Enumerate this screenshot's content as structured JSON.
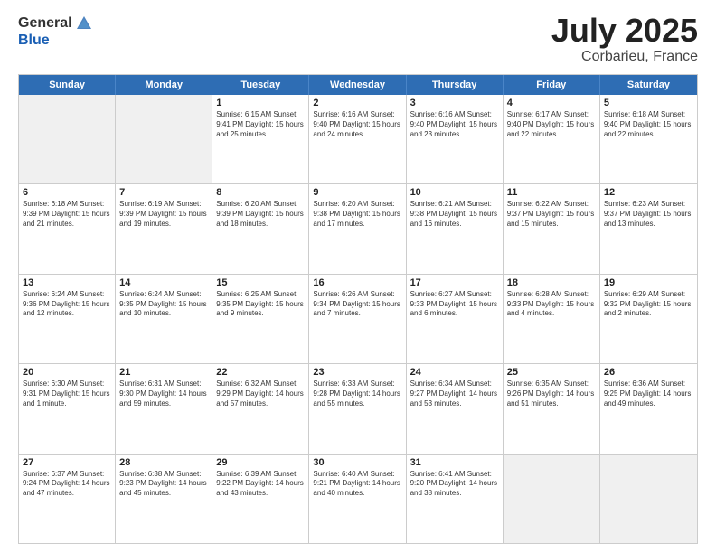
{
  "header": {
    "logo_general": "General",
    "logo_blue": "Blue",
    "title": "July 2025",
    "subtitle": "Corbarieu, France"
  },
  "weekdays": [
    "Sunday",
    "Monday",
    "Tuesday",
    "Wednesday",
    "Thursday",
    "Friday",
    "Saturday"
  ],
  "weeks": [
    [
      {
        "day": "",
        "text": "",
        "shaded": true
      },
      {
        "day": "",
        "text": "",
        "shaded": true
      },
      {
        "day": "1",
        "text": "Sunrise: 6:15 AM\nSunset: 9:41 PM\nDaylight: 15 hours\nand 25 minutes."
      },
      {
        "day": "2",
        "text": "Sunrise: 6:16 AM\nSunset: 9:40 PM\nDaylight: 15 hours\nand 24 minutes."
      },
      {
        "day": "3",
        "text": "Sunrise: 6:16 AM\nSunset: 9:40 PM\nDaylight: 15 hours\nand 23 minutes."
      },
      {
        "day": "4",
        "text": "Sunrise: 6:17 AM\nSunset: 9:40 PM\nDaylight: 15 hours\nand 22 minutes."
      },
      {
        "day": "5",
        "text": "Sunrise: 6:18 AM\nSunset: 9:40 PM\nDaylight: 15 hours\nand 22 minutes."
      }
    ],
    [
      {
        "day": "6",
        "text": "Sunrise: 6:18 AM\nSunset: 9:39 PM\nDaylight: 15 hours\nand 21 minutes."
      },
      {
        "day": "7",
        "text": "Sunrise: 6:19 AM\nSunset: 9:39 PM\nDaylight: 15 hours\nand 19 minutes."
      },
      {
        "day": "8",
        "text": "Sunrise: 6:20 AM\nSunset: 9:39 PM\nDaylight: 15 hours\nand 18 minutes."
      },
      {
        "day": "9",
        "text": "Sunrise: 6:20 AM\nSunset: 9:38 PM\nDaylight: 15 hours\nand 17 minutes."
      },
      {
        "day": "10",
        "text": "Sunrise: 6:21 AM\nSunset: 9:38 PM\nDaylight: 15 hours\nand 16 minutes."
      },
      {
        "day": "11",
        "text": "Sunrise: 6:22 AM\nSunset: 9:37 PM\nDaylight: 15 hours\nand 15 minutes."
      },
      {
        "day": "12",
        "text": "Sunrise: 6:23 AM\nSunset: 9:37 PM\nDaylight: 15 hours\nand 13 minutes."
      }
    ],
    [
      {
        "day": "13",
        "text": "Sunrise: 6:24 AM\nSunset: 9:36 PM\nDaylight: 15 hours\nand 12 minutes."
      },
      {
        "day": "14",
        "text": "Sunrise: 6:24 AM\nSunset: 9:35 PM\nDaylight: 15 hours\nand 10 minutes."
      },
      {
        "day": "15",
        "text": "Sunrise: 6:25 AM\nSunset: 9:35 PM\nDaylight: 15 hours\nand 9 minutes."
      },
      {
        "day": "16",
        "text": "Sunrise: 6:26 AM\nSunset: 9:34 PM\nDaylight: 15 hours\nand 7 minutes."
      },
      {
        "day": "17",
        "text": "Sunrise: 6:27 AM\nSunset: 9:33 PM\nDaylight: 15 hours\nand 6 minutes."
      },
      {
        "day": "18",
        "text": "Sunrise: 6:28 AM\nSunset: 9:33 PM\nDaylight: 15 hours\nand 4 minutes."
      },
      {
        "day": "19",
        "text": "Sunrise: 6:29 AM\nSunset: 9:32 PM\nDaylight: 15 hours\nand 2 minutes."
      }
    ],
    [
      {
        "day": "20",
        "text": "Sunrise: 6:30 AM\nSunset: 9:31 PM\nDaylight: 15 hours\nand 1 minute."
      },
      {
        "day": "21",
        "text": "Sunrise: 6:31 AM\nSunset: 9:30 PM\nDaylight: 14 hours\nand 59 minutes."
      },
      {
        "day": "22",
        "text": "Sunrise: 6:32 AM\nSunset: 9:29 PM\nDaylight: 14 hours\nand 57 minutes."
      },
      {
        "day": "23",
        "text": "Sunrise: 6:33 AM\nSunset: 9:28 PM\nDaylight: 14 hours\nand 55 minutes."
      },
      {
        "day": "24",
        "text": "Sunrise: 6:34 AM\nSunset: 9:27 PM\nDaylight: 14 hours\nand 53 minutes."
      },
      {
        "day": "25",
        "text": "Sunrise: 6:35 AM\nSunset: 9:26 PM\nDaylight: 14 hours\nand 51 minutes."
      },
      {
        "day": "26",
        "text": "Sunrise: 6:36 AM\nSunset: 9:25 PM\nDaylight: 14 hours\nand 49 minutes."
      }
    ],
    [
      {
        "day": "27",
        "text": "Sunrise: 6:37 AM\nSunset: 9:24 PM\nDaylight: 14 hours\nand 47 minutes."
      },
      {
        "day": "28",
        "text": "Sunrise: 6:38 AM\nSunset: 9:23 PM\nDaylight: 14 hours\nand 45 minutes."
      },
      {
        "day": "29",
        "text": "Sunrise: 6:39 AM\nSunset: 9:22 PM\nDaylight: 14 hours\nand 43 minutes."
      },
      {
        "day": "30",
        "text": "Sunrise: 6:40 AM\nSunset: 9:21 PM\nDaylight: 14 hours\nand 40 minutes."
      },
      {
        "day": "31",
        "text": "Sunrise: 6:41 AM\nSunset: 9:20 PM\nDaylight: 14 hours\nand 38 minutes."
      },
      {
        "day": "",
        "text": "",
        "shaded": true
      },
      {
        "day": "",
        "text": "",
        "shaded": true
      }
    ]
  ]
}
